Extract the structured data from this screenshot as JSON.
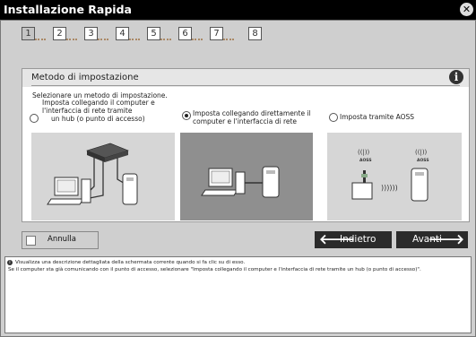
{
  "window": {
    "title": "Installazione Rapida"
  },
  "steps": [
    "1",
    "2",
    "3",
    "4",
    "5",
    "6",
    "7",
    "8"
  ],
  "active_step": "1",
  "section": {
    "title": "Metodo di impostazione"
  },
  "prompt": "Selezionare un metodo di impostazione.",
  "options": [
    {
      "lines": [
        "Imposta collegando il computer e",
        "l'interfaccia di rete tramite",
        "un hub (o punto di accesso)"
      ],
      "selected": false
    },
    {
      "lines": [
        "Imposta collegando direttamente il",
        "computer e l'interfaccia di rete"
      ],
      "selected": true
    },
    {
      "lines": [
        "Imposta tramite AOSS"
      ],
      "selected": false
    }
  ],
  "aoss_labels": [
    "AOSS",
    "AOSS"
  ],
  "buttons": {
    "cancel": "Annulla",
    "back": "Indietro",
    "next": "Avanti"
  },
  "description": {
    "line1": "Visualizza una descrizione dettagliata della schermata corrente quando si fa clic su di esso.",
    "line2": "Se il computer sta già comunicando con il punto di accesso, selezionare \"Imposta collegando il computer e l'interfaccia di rete tramite un hub (o punto di accesso)\"."
  }
}
